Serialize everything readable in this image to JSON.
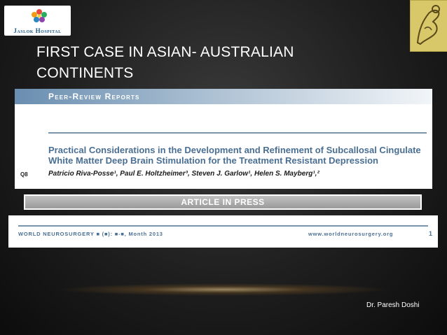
{
  "logo": {
    "text": "Jaslok Hospital"
  },
  "slide": {
    "title": "FIRST CASE IN ASIAN- AUSTRALIAN CONTINENTS"
  },
  "article": {
    "header": "Peer-Review Reports",
    "title": "Practical Considerations in the Development and Refinement of Subcallosal Cingulate White Matter Deep Brain Stimulation for the Treatment Resistant Depression",
    "q_label": "Q8",
    "authors": "Patricio Riva-Posse¹, Paul E. Holtzheimer³, Steven J. Garlow¹, Helen S. Mayberg¹,²"
  },
  "banner": {
    "text": "ARTICLE IN PRESS"
  },
  "journal": {
    "left": "WORLD NEUROSURGERY ■ (■): ■-■, Month 2013",
    "url": "www.worldneurosurgery.org",
    "page": "1"
  },
  "footer": {
    "author": "Dr. Paresh Doshi"
  },
  "colors": {
    "accent_blue": "#4a6f93",
    "emblem_gold": "#d8c86a"
  }
}
